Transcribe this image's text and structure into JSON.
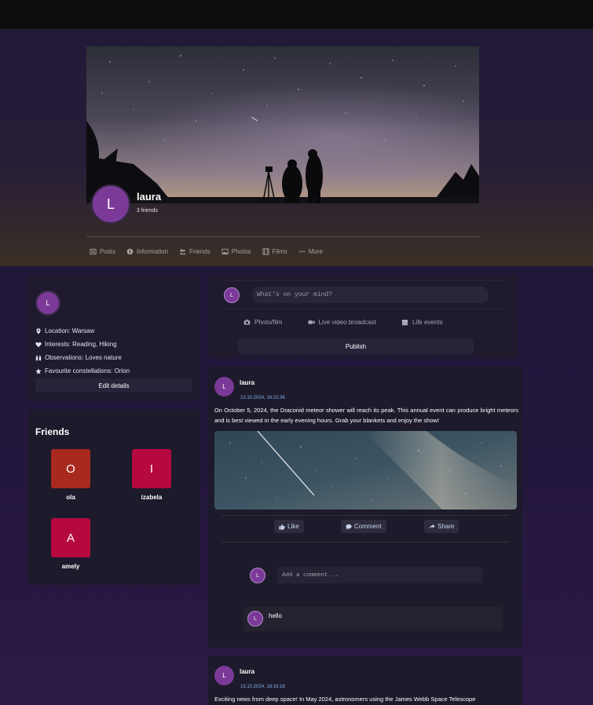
{
  "profile": {
    "avatar_initial": "L",
    "name": "laura",
    "friends_count": "3 friends"
  },
  "profile_nav": [
    {
      "label": "Posts",
      "icon": "newspaper-icon"
    },
    {
      "label": "Information",
      "icon": "info-icon"
    },
    {
      "label": "Friends",
      "icon": "users-icon"
    },
    {
      "label": "Photos",
      "icon": "image-icon"
    },
    {
      "label": "Films",
      "icon": "film-icon"
    },
    {
      "label": "More",
      "icon": "ellipsis-icon"
    }
  ],
  "about": {
    "avatar_initial": "L",
    "items": [
      {
        "icon": "location-pin-icon",
        "text": "Location: Warsaw"
      },
      {
        "icon": "heart-icon",
        "text": "Interests: Reading, Hiking"
      },
      {
        "icon": "binoculars-icon",
        "text": "Observations: Loves nature"
      },
      {
        "icon": "star-icon",
        "text": "Favourite constellations: Orion"
      }
    ],
    "edit_label": "Edit details"
  },
  "friends": {
    "title": "Friends",
    "list": [
      {
        "initial": "O",
        "name": "ola",
        "color": "#a8291e"
      },
      {
        "initial": "I",
        "name": "izabela",
        "color": "#b5093f"
      },
      {
        "initial": "A",
        "name": "amely",
        "color": "#b5093f"
      }
    ]
  },
  "composer": {
    "avatar_initial": "L",
    "placeholder": "What's on your mind?",
    "actions": [
      {
        "label": "Photo/film",
        "icon": "camera-icon"
      },
      {
        "label": "Live video broadcast",
        "icon": "video-icon"
      },
      {
        "label": "Life events",
        "icon": "calendar-icon"
      }
    ],
    "publish_label": "Publish"
  },
  "posts": [
    {
      "avatar_initial": "L",
      "author": "laura",
      "date": "10.10.2024, 16:22:36",
      "text": "On October 5, 2024, the Draconid meteor shower will reach its peak. This annual event can produce bright meteors and is best viewed in the early evening hours. Grab your blankets and enjoy the show!",
      "actions": {
        "like": "Like",
        "comment": "Comment",
        "share": "Share"
      },
      "comment_avatar_initial": "L",
      "comment_placeholder": "Add a comment...",
      "comments": [
        {
          "avatar_initial": "L",
          "text": "hello"
        }
      ]
    },
    {
      "avatar_initial": "L",
      "author": "laura",
      "date": "15.10.2024, 18:16:18",
      "text": "Exciting news from deep space! In May 2024, astronomers using the James Webb Space Telescope"
    }
  ],
  "colors": {
    "accent_avatar": "#7b3a98",
    "date_blue": "#7fb0e6",
    "card_bg": "#1d1a2b"
  }
}
